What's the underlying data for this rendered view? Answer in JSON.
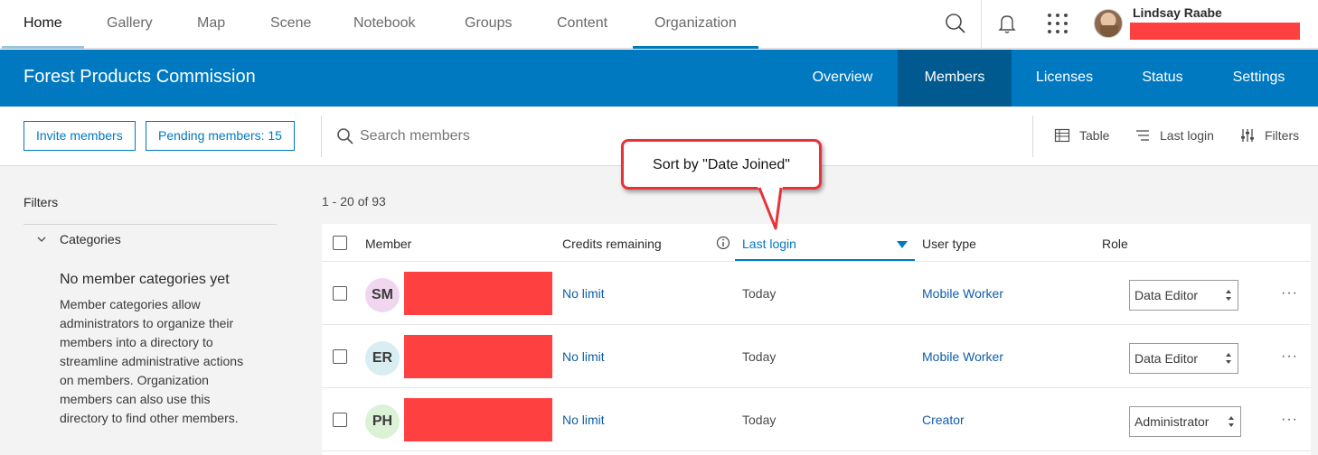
{
  "topnav": {
    "tabs": [
      "Home",
      "Gallery",
      "Map",
      "Scene",
      "Notebook",
      "Groups",
      "Content",
      "Organization"
    ],
    "user_name": "Lindsay Raabe"
  },
  "orgbar": {
    "org_name": "Forest Products Commission",
    "tabs": [
      "Overview",
      "Members",
      "Licenses",
      "Status",
      "Settings"
    ],
    "active_tab": "Members"
  },
  "toolbar": {
    "invite_label": "Invite members",
    "pending_label": "Pending members: 15",
    "search_placeholder": "Search members",
    "view_label": "Table",
    "sort_label": "Last login",
    "filters_label": "Filters"
  },
  "filters": {
    "title": "Filters",
    "categories_label": "Categories",
    "empty_title": "No member categories yet",
    "empty_desc": "Member categories allow administrators to organize their members into a directory to streamline administrative actions on members. Organization members can also use this directory to find other members."
  },
  "table": {
    "count": "1 - 20 of 93",
    "headers": {
      "member": "Member",
      "credits": "Credits remaining",
      "last_login": "Last login",
      "user_type": "User type",
      "role": "Role"
    },
    "rows": [
      {
        "initials": "SM",
        "avatar_color": "#f1d6f0",
        "credits": "No limit",
        "last_login": "Today",
        "user_type": "Mobile Worker",
        "role": "Data Editor"
      },
      {
        "initials": "ER",
        "avatar_color": "#d8eef2",
        "credits": "No limit",
        "last_login": "Today",
        "user_type": "Mobile Worker",
        "role": "Data Editor"
      },
      {
        "initials": "PH",
        "avatar_color": "#dcf2d6",
        "credits": "No limit",
        "last_login": "Today",
        "user_type": "Creator",
        "role": "Administrator"
      }
    ]
  },
  "callout": {
    "text": "Sort by \"Date Joined\""
  },
  "colors": {
    "brand_blue": "#0079c1",
    "active_tab": "#005a8f",
    "redaction": "#ff4040",
    "callout_border": "#e8323a"
  },
  "icons": [
    "search-icon",
    "bell-icon",
    "apps-grid-icon",
    "table-icon",
    "sort-icon",
    "filter-icon",
    "info-icon",
    "chevron-down-icon",
    "sort-desc-icon",
    "more-icon"
  ]
}
